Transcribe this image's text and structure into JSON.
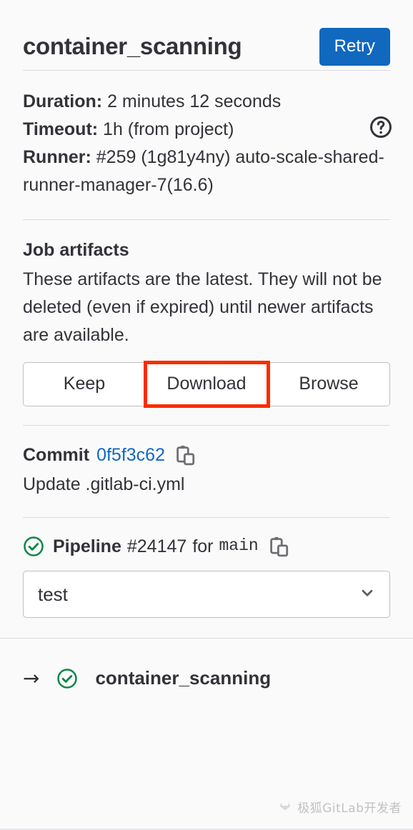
{
  "header": {
    "job_title": "container_scanning",
    "retry_label": "Retry"
  },
  "details": {
    "duration_label": "Duration:",
    "duration_value": "2 minutes 12 seconds",
    "timeout_label": "Timeout:",
    "timeout_value": "1h (from project)",
    "runner_label": "Runner:",
    "runner_value": "#259 (1g81y4ny) auto-scale-shared-runner-manager-7(16.6)",
    "help_icon": "question-circle-icon"
  },
  "artifacts": {
    "title": "Job artifacts",
    "description": "These artifacts are the latest. They will not be deleted (even if expired) until newer artifacts are available.",
    "buttons": [
      {
        "label": "Keep",
        "highlighted": false
      },
      {
        "label": "Download",
        "highlighted": true
      },
      {
        "label": "Browse",
        "highlighted": false
      }
    ],
    "highlight_color": "#fa2c00"
  },
  "commit": {
    "label": "Commit",
    "sha": "0f5f3c62",
    "sha_color": "#1068bf",
    "copy_icon": "copy-to-clipboard-icon",
    "message": "Update .gitlab-ci.yml"
  },
  "pipeline": {
    "status_icon": "status-success-icon",
    "status_color": "#108548",
    "label": "Pipeline",
    "number": "#24147",
    "for_text": "for",
    "ref": "main",
    "copy_icon": "copy-to-clipboard-icon",
    "stage_selected": "test",
    "chevron_icon": "chevron-down-icon"
  },
  "jobs": {
    "arrow_icon": "arrow-right-icon",
    "items": [
      {
        "status_icon": "status-success-icon",
        "name": "container_scanning"
      }
    ]
  },
  "watermark": {
    "text": "极狐GitLab开发者",
    "logo_icon": "fox-logo-icon"
  },
  "theme": {
    "background": "#fafafa",
    "text": "#333238",
    "border": "#bfbfc3",
    "divider": "#dcdcde",
    "accent_blue": "#1068bf"
  }
}
